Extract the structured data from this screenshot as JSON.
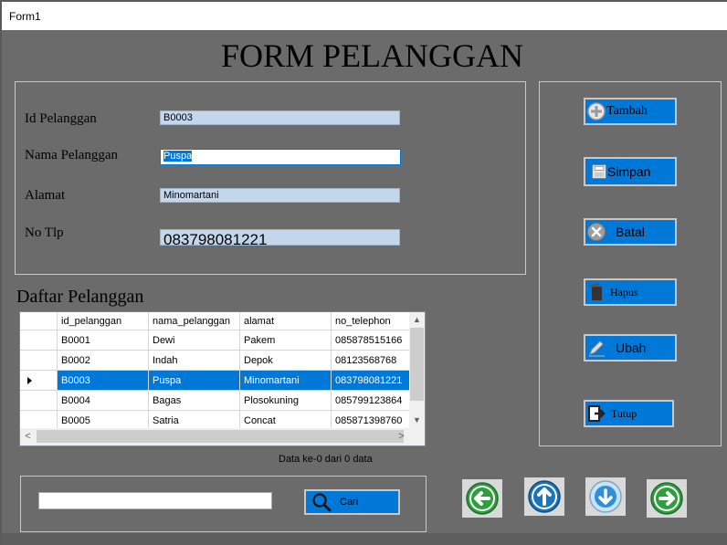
{
  "window": {
    "title": "Form1"
  },
  "form": {
    "heading": "FORM PELANGGAN",
    "fields": {
      "id": {
        "label": "Id Pelanggan",
        "value": "B0003"
      },
      "nama": {
        "label": "Nama Pelanggan",
        "value": "Puspa"
      },
      "alamat": {
        "label": "Alamat",
        "value": "Minomartani"
      },
      "tlp": {
        "label": "No Tlp",
        "value": "083798081221"
      }
    }
  },
  "buttons": {
    "tambah": "Tambah",
    "simpan": "Simpan",
    "batal": "Batal",
    "hapus": "Hapus",
    "ubah": "Ubah",
    "tutup": "Tutup",
    "cari": "Cari"
  },
  "list": {
    "title": "Daftar Pelanggan",
    "columns": [
      "id_pelanggan",
      "nama_pelanggan",
      "alamat",
      "no_telephon"
    ],
    "rows": [
      [
        "B0001",
        "Dewi",
        "Pakem",
        "085878515166"
      ],
      [
        "B0002",
        "Indah",
        "Depok",
        "08123568768"
      ],
      [
        "B0003",
        "Puspa",
        "Minomartani",
        "083798081221"
      ],
      [
        "B0004",
        "Bagas",
        "Plosokuning",
        "085799123864"
      ],
      [
        "B0005",
        "Satria",
        "Concat",
        "085871398760"
      ]
    ],
    "selected_row": 2,
    "status": "Data ke-0 dari 0 data"
  },
  "search": {
    "value": ""
  },
  "colors": {
    "accent": "#0078d7",
    "background": "#6b6b6b",
    "nav_green": "#2e9e3e",
    "nav_blue": "#1b75b8"
  },
  "icons": [
    "add-icon",
    "save-icon",
    "cancel-icon",
    "delete-icon",
    "edit-icon",
    "exit-icon",
    "search-icon",
    "first-arrow-icon",
    "prev-arrow-icon",
    "next-arrow-icon",
    "last-arrow-icon"
  ]
}
